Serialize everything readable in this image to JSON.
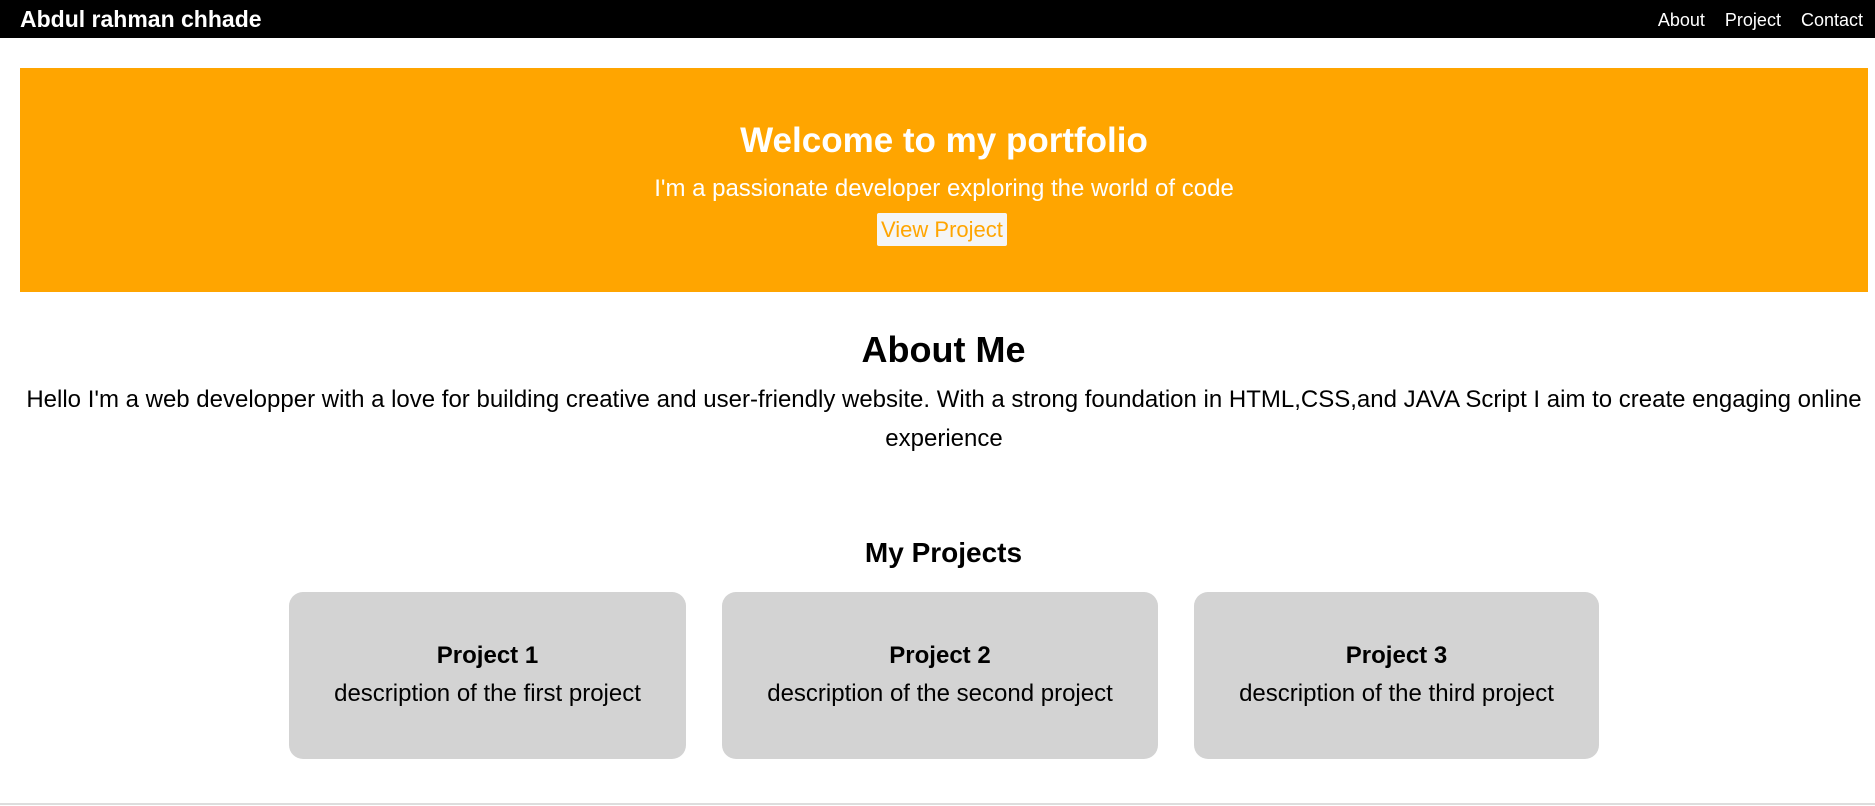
{
  "navbar": {
    "brand": "Abdul rahman chhade",
    "links": [
      "About",
      "Project",
      "Contact"
    ]
  },
  "hero": {
    "title": "Welcome to my portfolio",
    "subtitle": "I'm a passionate developer exploring the world of code",
    "button_label": "View Project"
  },
  "about": {
    "title": "About Me",
    "text": "Hello I'm a web developper with a love for building creative and user-friendly website. With a strong foundation in HTML,CSS,and JAVA Script I aim to create engaging online experience"
  },
  "projects": {
    "title": "My Projects",
    "items": [
      {
        "name": "Project 1",
        "description": "description of the first project"
      },
      {
        "name": "Project 2",
        "description": "description of the second project"
      },
      {
        "name": "Project 3",
        "description": "description of the third project"
      }
    ]
  },
  "colors": {
    "navbar_bg": "#000000",
    "hero_bg": "#ffa500",
    "card_bg": "#d3d3d3",
    "text": "#000000",
    "hero_text": "#ffffff"
  }
}
